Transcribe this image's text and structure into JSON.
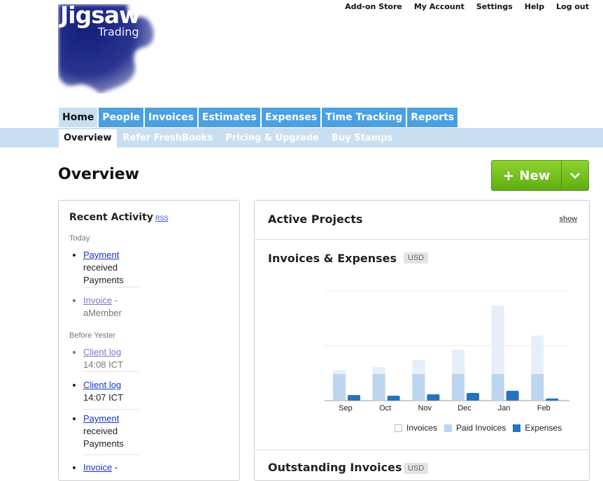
{
  "brand": {
    "name_line1": "Jigsaw",
    "name_line2": "Trading",
    "logo_color": "#1f2a80"
  },
  "top_links": [
    "Add-on Store",
    "My Account",
    "Settings",
    "Help",
    "Log out"
  ],
  "tabs": [
    "Home",
    "People",
    "Invoices",
    "Estimates",
    "Expenses",
    "Time Tracking",
    "Reports"
  ],
  "active_tab": "Home",
  "subnav": [
    "Overview",
    "Refer FreshBooks",
    "Pricing & Upgrade",
    "Buy Stamps"
  ],
  "page": {
    "title": "Overview"
  },
  "new_button": {
    "label": "New",
    "plus": "+",
    "color": "#6fbe1c"
  },
  "recent_activity": {
    "title": "Recent Activity",
    "rss": "RSS",
    "sections": [
      {
        "label": "Today",
        "items": [
          {
            "link": "Payment",
            "text": "received",
            "text2": "Payments"
          },
          {
            "link": "Invoice",
            "suffix": " -",
            "text": "aMember"
          }
        ]
      },
      {
        "label": "Before Yester",
        "items": [
          {
            "link": "Client log",
            "text": "14:08 ICT"
          },
          {
            "link": "Client log",
            "text": "14:07 ICT"
          },
          {
            "link": "Payment",
            "text": "received",
            "text2": "Payments"
          },
          {
            "link": "Invoice",
            "suffix": " -"
          }
        ]
      }
    ]
  },
  "active_projects": {
    "title": "Active Projects",
    "show": "show"
  },
  "invoices_expenses": {
    "title": "Invoices & Expenses",
    "currency": "USD"
  },
  "outstanding_invoices": {
    "title": "Outstanding Invoices",
    "currency": "USD"
  },
  "chart_data": {
    "type": "bar",
    "categories": [
      "Sep",
      "Oct",
      "Nov",
      "Dec",
      "Jan",
      "Feb"
    ],
    "series": [
      {
        "name": "Invoices",
        "values": [
          44,
          48,
          58,
          73,
          136,
          93
        ],
        "color": "#e6eff9"
      },
      {
        "name": "Paid Invoices",
        "values": [
          38,
          38,
          38,
          38,
          38,
          38
        ],
        "color": "#bcd6f0"
      },
      {
        "name": "Expenses",
        "values": [
          8,
          7,
          9,
          11,
          14,
          3
        ],
        "color": "#2674bf"
      }
    ],
    "ylim": [
      0,
      157
    ],
    "grid": true,
    "legend": "bottom-right"
  }
}
